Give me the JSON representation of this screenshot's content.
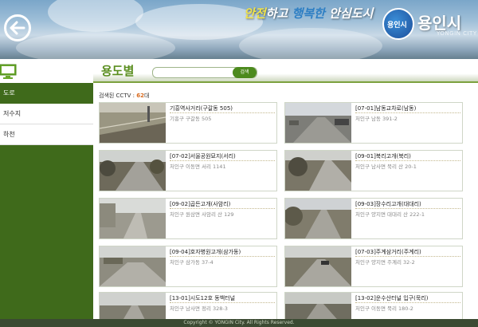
{
  "header": {
    "slogan": {
      "w1": "안전",
      "w2": "하고 ",
      "w3": "행복한",
      "w4": " 안심도시"
    },
    "logo_text": "용인시",
    "city_name": "용인시",
    "city_en": "YONGIN CITY"
  },
  "sidebar": {
    "items": [
      {
        "label": "도로",
        "active": true
      },
      {
        "label": "저수지",
        "active": false
      },
      {
        "label": "하천",
        "active": false
      }
    ]
  },
  "main": {
    "title": "용도별",
    "search": {
      "button_label": "검색",
      "value": ""
    },
    "count": {
      "prefix": "검색된 CCTV : ",
      "number": "62",
      "suffix": "대"
    },
    "cards": [
      {
        "name": "기흥역사거리(구갈동 505)",
        "address": "기흥구 구갈동 505"
      },
      {
        "name": "[07-01]남동교차로(남동)",
        "address": "처인구 남동 391-2"
      },
      {
        "name": "[07-02]서울공원묘지(서리)",
        "address": "처인구 이동면 서리 1141"
      },
      {
        "name": "[09-01]북리고개(북리)",
        "address": "처인구 남사면 북리 산 20-1"
      },
      {
        "name": "[09-02]곱든고개(사암리)",
        "address": "처인구 원삼면 사암리 산 129"
      },
      {
        "name": "[09-03]장수리고개(대대리)",
        "address": "처인구 양지면 대대리 산 222-1"
      },
      {
        "name": "[09-04]호자병원고개(삼가동)",
        "address": "처인구 삼가동 37-4"
      },
      {
        "name": "[07-03]주계삼거리(주계리)",
        "address": "처인구 양지면 주계리 32-2"
      },
      {
        "name": "[13-01]시도12호 동백터널",
        "address": "처인구 남사면 정리 328-3"
      },
      {
        "name": "[13-02]운수산터널 입구(묵리)",
        "address": "처인구 이동면 묵리 180-2"
      }
    ]
  },
  "footer": {
    "text": "Copyright © YONGIN City. All Rights Reserved."
  }
}
